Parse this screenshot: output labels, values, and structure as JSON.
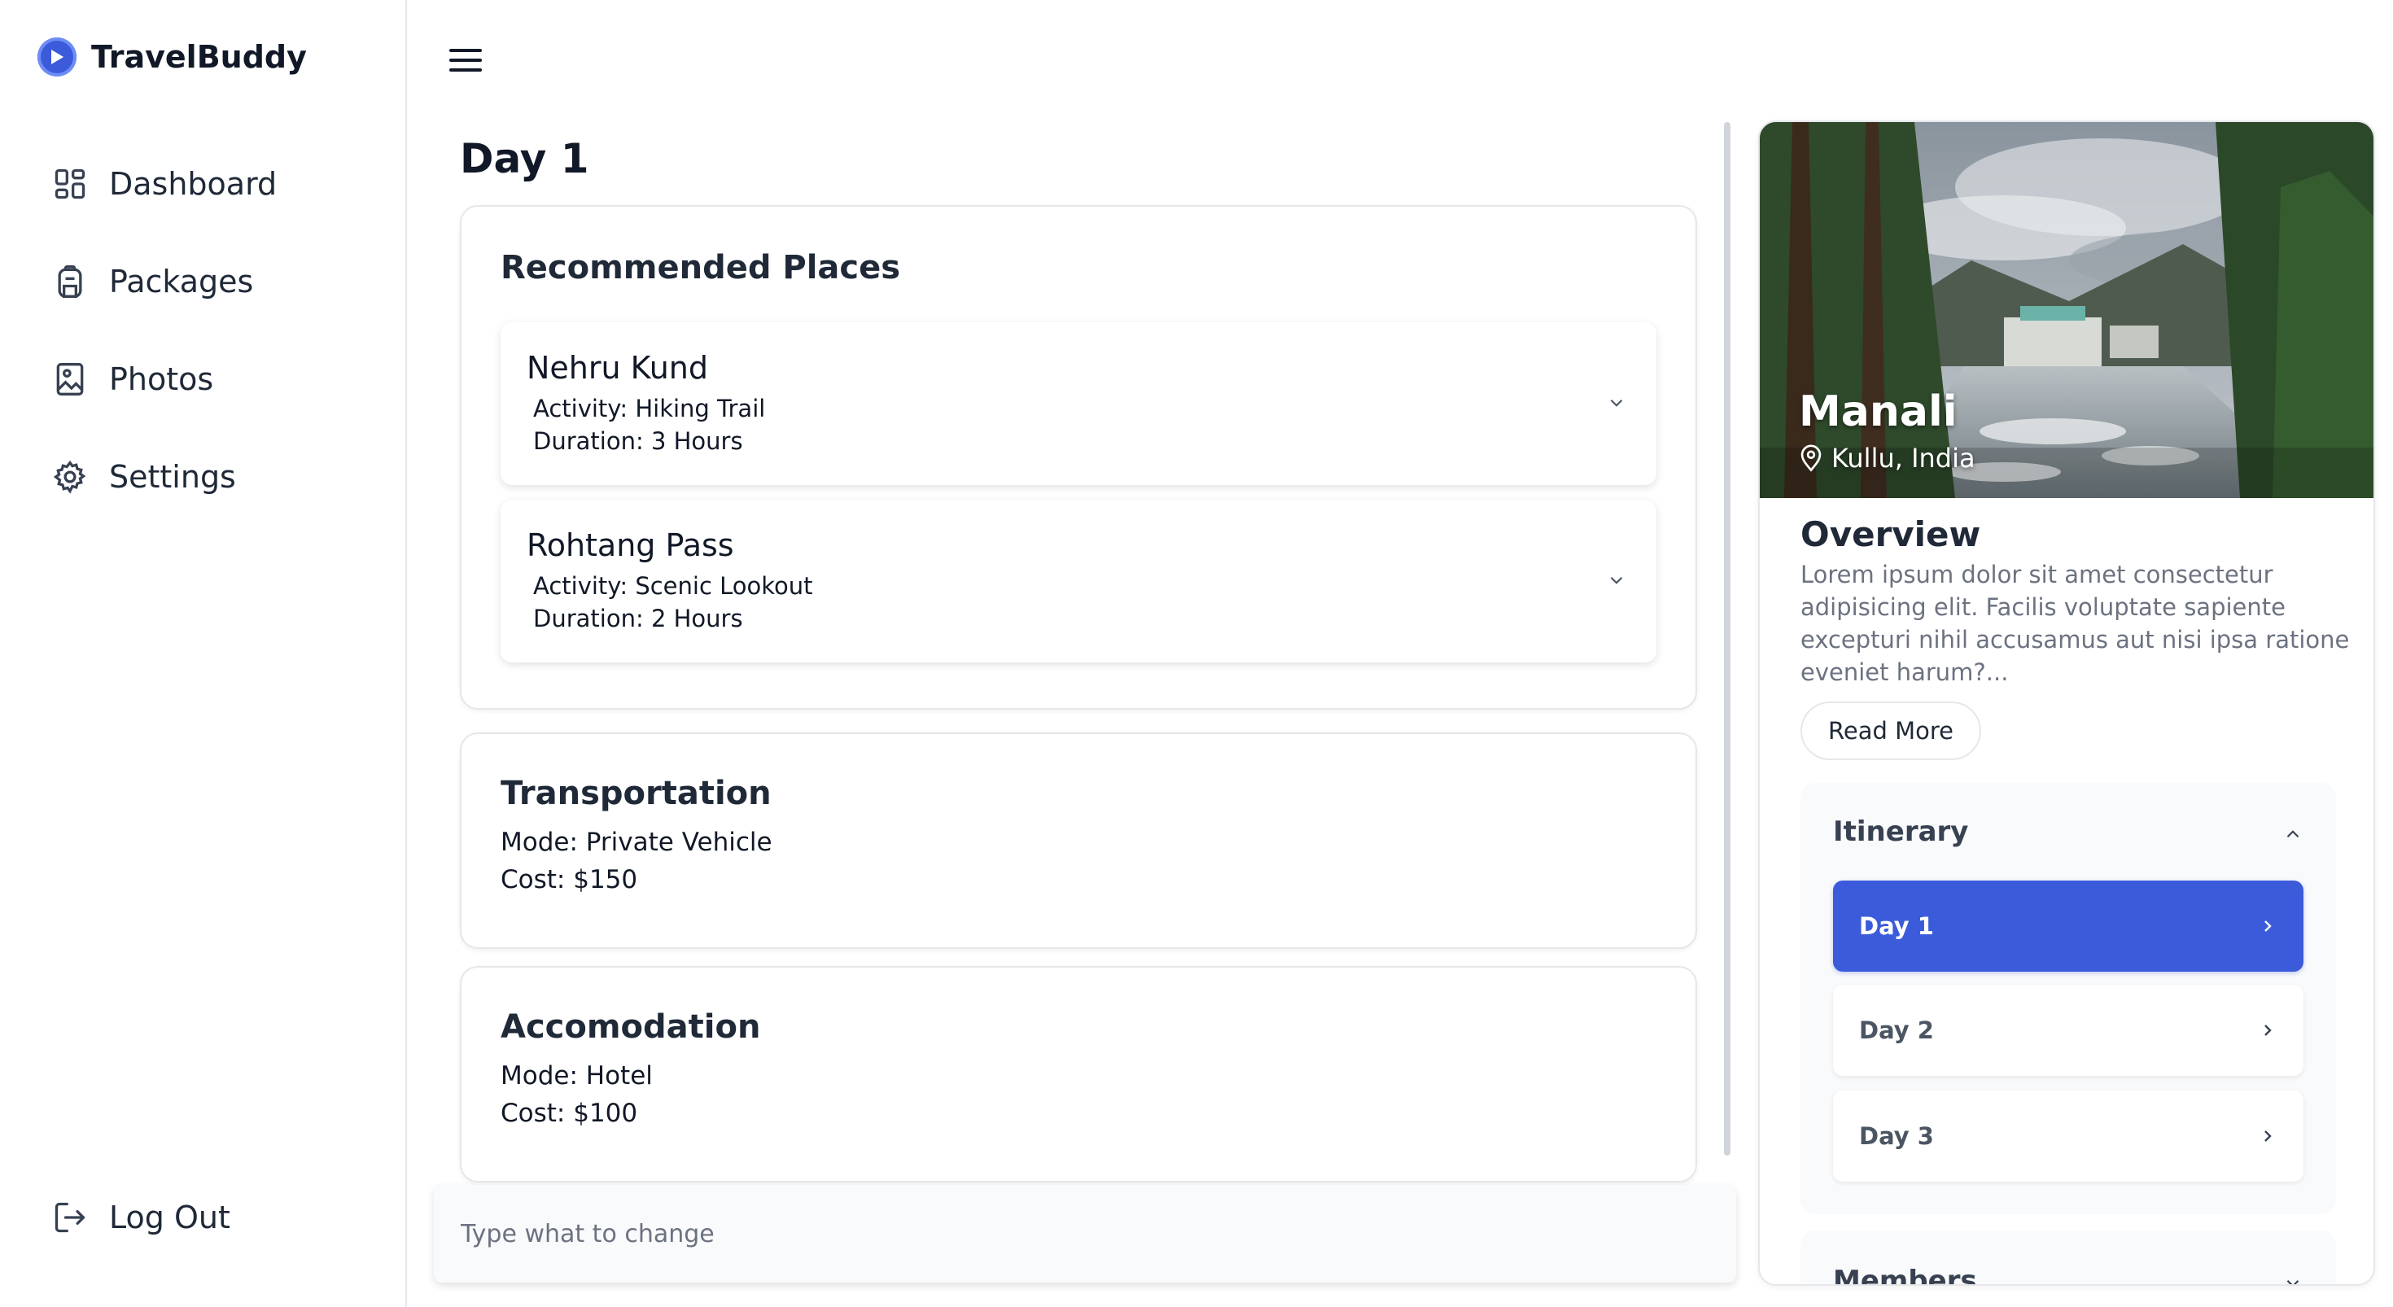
{
  "brand": {
    "name": "TravelBuddy",
    "accent": "#3b5bdb"
  },
  "sidebar": {
    "items": [
      {
        "label": "Dashboard",
        "icon": "dashboard-grid-icon"
      },
      {
        "label": "Packages",
        "icon": "backpack-icon"
      },
      {
        "label": "Photos",
        "icon": "photo-icon"
      },
      {
        "label": "Settings",
        "icon": "gear-icon"
      }
    ],
    "logout": {
      "label": "Log Out",
      "icon": "logout-icon"
    }
  },
  "topbar": {
    "menu_icon": "hamburger-menu-icon"
  },
  "main": {
    "day_title": "Day 1",
    "recommended": {
      "title": "Recommended Places",
      "places": [
        {
          "name": "Nehru Kund",
          "activity": "Activity: Hiking Trail",
          "duration": "Duration: 3 Hours"
        },
        {
          "name": "Rohtang Pass",
          "activity": "Activity: Scenic Lookout",
          "duration": "Duration: 2 Hours"
        }
      ]
    },
    "transportation": {
      "title": "Transportation",
      "mode": "Mode: Private Vehicle",
      "cost": "Cost: $150"
    },
    "accomodation": {
      "title": "Accomodation",
      "mode": "Mode: Hotel",
      "cost": "Cost: $100"
    },
    "change_input": {
      "placeholder": "Type what to change",
      "value": ""
    }
  },
  "panel": {
    "destination": "Manali",
    "location": "Kullu, India",
    "overview": {
      "title": "Overview",
      "text": "Lorem ipsum dolor sit amet consectetur adipisicing elit. Facilis voluptate sapiente excepturi nihil accusamus aut nisi ipsa ratione eveniet harum?...",
      "read_more": "Read More"
    },
    "itinerary": {
      "title": "Itinerary",
      "days": [
        {
          "label": "Day 1",
          "active": true
        },
        {
          "label": "Day 2",
          "active": false
        },
        {
          "label": "Day 3",
          "active": false
        }
      ]
    },
    "members": {
      "title": "Members"
    }
  }
}
